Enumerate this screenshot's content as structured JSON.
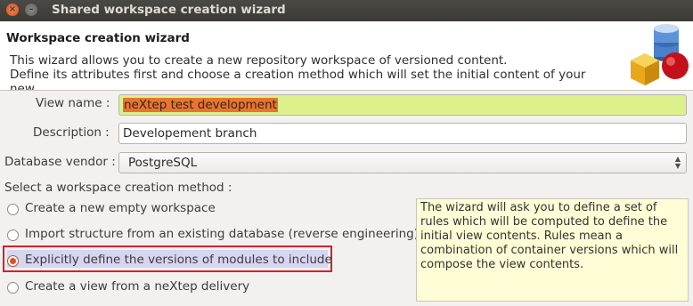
{
  "window": {
    "title": "Shared workspace creation wizard",
    "controls": {
      "close": "×",
      "minimize": "–"
    }
  },
  "header": {
    "title": "Workspace creation wizard",
    "description_line1": "This wizard allows you to create a new repository workspace of versioned content.",
    "description_line2": "Define its attributes first and choose a creation method which will set the initial content of your new",
    "icon": "database-cube-sphere-icon"
  },
  "form": {
    "view_name_label": "View name :",
    "view_name_value": "neXtep test development",
    "description_label": "Description :",
    "description_value": "Developement branch",
    "vendor_label": "Database vendor :",
    "vendor_value": "PostgreSQL"
  },
  "methods": {
    "heading": "Select a workspace creation method :",
    "options": [
      {
        "label": "Create a new empty workspace",
        "checked": false
      },
      {
        "label": "Import structure from an existing database (reverse engineering)",
        "checked": false
      },
      {
        "label": "Explicitly define the versions of modules to include",
        "checked": true
      },
      {
        "label": "Create a view from a neXtep delivery",
        "checked": false
      }
    ]
  },
  "info_text": "The wizard will ask you to define a set of rules which will be computed to define the initial view contents. Rules mean a combination of container versions which will compose the view contents.",
  "colors": {
    "accent": "#e8742f",
    "highlight_field": "#dcf08c",
    "focus_border": "#d4202c",
    "info_background": "#fffdd5"
  }
}
